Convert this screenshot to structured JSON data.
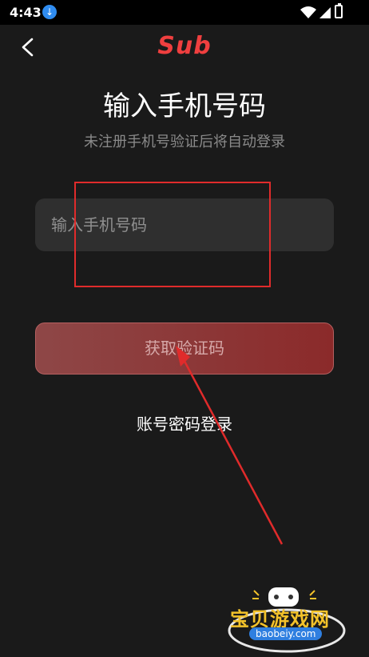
{
  "status_bar": {
    "time": "4:43"
  },
  "header": {
    "brand": "Sub"
  },
  "main": {
    "title": "输入手机号码",
    "subtitle": "未注册手机号验证后将自动登录",
    "phone_placeholder": "输入手机号码",
    "get_code_label": "获取验证码",
    "password_login_label": "账号密码登录"
  },
  "watermark": {
    "name": "宝贝游戏网",
    "url": "baobeiy.com"
  },
  "colors": {
    "brand": "#ef3f3f",
    "button": "#8b2a2a",
    "annotation": "#e02b2b"
  }
}
